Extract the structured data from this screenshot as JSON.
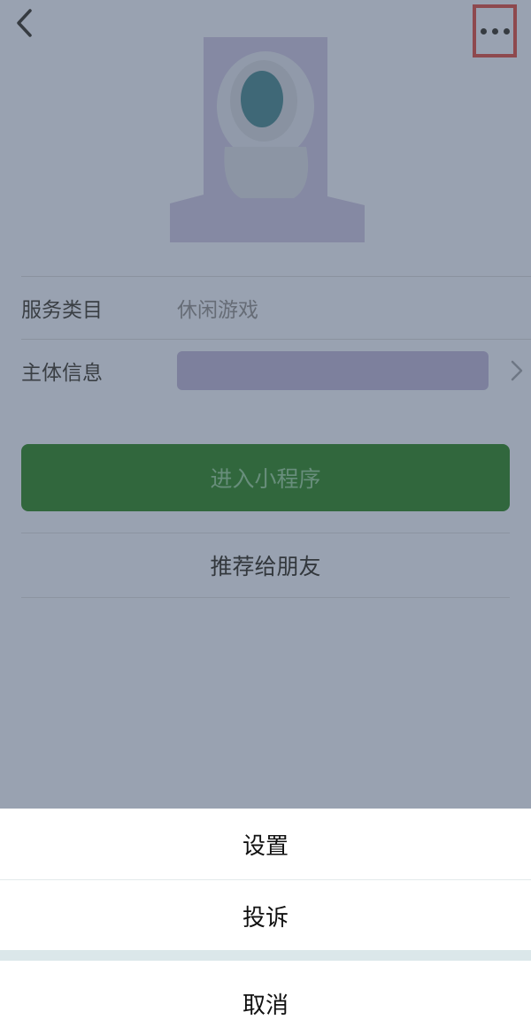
{
  "nav": {
    "back_icon": "chevron-left-icon",
    "more_icon": "ellipsis-icon",
    "highlight_color": "#e53935"
  },
  "profile": {
    "avatar_icon": "mascot-avatar"
  },
  "info": {
    "rows": [
      {
        "label": "服务类目",
        "value": "休闲游戏"
      },
      {
        "label": "主体信息",
        "value": ""
      }
    ]
  },
  "actions": {
    "enter_label": "进入小程序",
    "enter_color": "#0f7b13",
    "recommend_label": "推荐给朋友"
  },
  "sheet": {
    "items": [
      {
        "label": "设置"
      },
      {
        "label": "投诉"
      }
    ],
    "cancel_label": "取消"
  }
}
